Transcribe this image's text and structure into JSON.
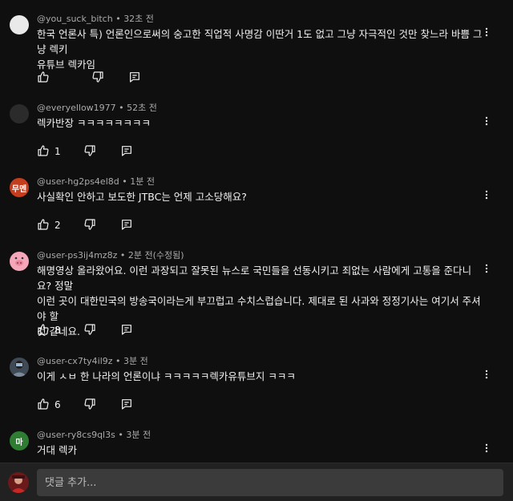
{
  "comments": [
    {
      "author": "@you_suck_bitch",
      "time": "32초 전",
      "lines": [
        "한국 언론사 특) 언론인으로써의 숭고한 직업적 사명감 이딴거 1도 없고 그냥 자극적인 것만 찾느라 바쁨 그냥 렉키",
        "유튜브 렉카임"
      ],
      "likes": "",
      "avatar": {
        "type": "plain",
        "color": "#e9e9e9"
      }
    },
    {
      "author": "@everyellow1977",
      "time": "52초 전",
      "lines": [
        "렉카반장 ㅋㅋㅋㅋㅋㅋㅋㅋ"
      ],
      "likes": "1",
      "avatar": {
        "type": "plain",
        "color": "#2b2b2b"
      }
    },
    {
      "author": "@user-hg2ps4el8d",
      "time": "1분 전",
      "lines": [
        "사실확인 안하고 보도한 JTBC는 언제 고소당해요?"
      ],
      "likes": "2",
      "avatar": {
        "type": "text",
        "text": "무멘",
        "color": "#c43d1e"
      }
    },
    {
      "author": "@user-ps3ij4mz8z",
      "time": "2분 전(수정됨)",
      "lines": [
        "해명영상 올라왔어요. 이런 과장되고 잘못된 뉴스로 국민들을 선동시키고 죄없는 사람에게 고통을 준다니요? 정말",
        "이런 곳이 대한민국의 방송국이라는게 부끄럽고 수치스럽습니다. 제대로 된 사과와 정정기사는 여기서 주셔야 할",
        "것 같네요."
      ],
      "likes": "8",
      "avatar": {
        "type": "pig",
        "color": "#f4a7b9"
      }
    },
    {
      "author": "@user-cx7ty4il9z",
      "time": "3분 전",
      "lines": [
        "이게 ㅅㅂ 한 나라의 언론이냐 ㅋㅋㅋㅋㅋ렉카유튜브지 ㅋㅋㅋ"
      ],
      "likes": "6",
      "avatar": {
        "type": "photo",
        "color": "#7a8a9a"
      }
    },
    {
      "author": "@user-ry8cs9ql3s",
      "time": "3분 전",
      "lines": [
        "거대 렉카"
      ],
      "likes": "",
      "avatar": {
        "type": "text",
        "text": "마",
        "color": "#2e7d32"
      }
    }
  ],
  "add_comment": {
    "placeholder": "댓글 추가..."
  },
  "icons": {
    "like": "thumb-up-icon",
    "dislike": "thumb-down-icon",
    "reply": "reply-icon",
    "more": "more-vert-icon"
  }
}
